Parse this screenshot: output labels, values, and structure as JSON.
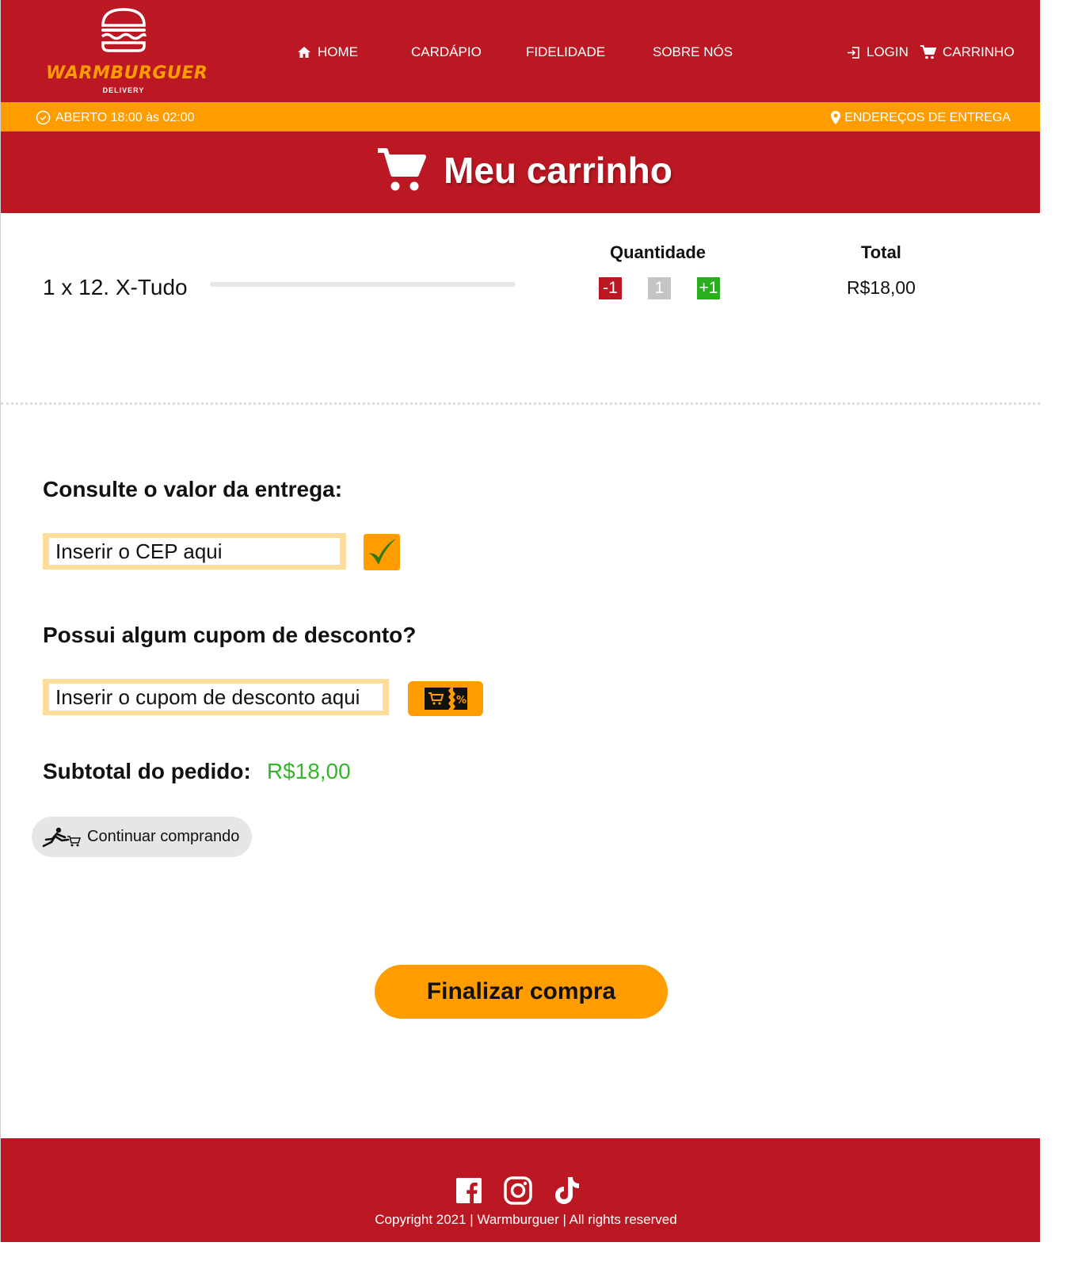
{
  "brand": {
    "name": "WARMBURGUER",
    "tagline": "DELIVERY"
  },
  "nav": {
    "home": "HOME",
    "menu": "CARDÁPIO",
    "loyalty": "FIDELIDADE",
    "about": "SOBRE NÓS",
    "login": "LOGIN",
    "cart": "CARRINHO"
  },
  "status": {
    "hours": "ABERTO 18:00 às 02:00",
    "addresses": "ENDEREÇOS DE ENTREGA"
  },
  "page": {
    "title": "Meu carrinho",
    "icon": "shopping-cart-icon"
  },
  "cart": {
    "headers": {
      "quantity": "Quantidade",
      "total": "Total"
    },
    "items": [
      {
        "name": "1 x 12. X-Tudo",
        "decrease": "-1",
        "quantity": "1",
        "increase": "+1",
        "total": "R$18,00"
      }
    ]
  },
  "delivery": {
    "title": "Consulte o valor da entrega:",
    "cep_placeholder": "Inserir o CEP aqui",
    "cep_value": "",
    "submit_icon": "checkmark-icon"
  },
  "coupon": {
    "title": "Possui algum cupom de desconto?",
    "placeholder": "Inserir o cupom de desconto aqui",
    "value": "",
    "apply_icon": "discount-coupon-icon"
  },
  "summary": {
    "subtotal_label": "Subtotal do pedido:",
    "subtotal_value": "R$18,00"
  },
  "actions": {
    "continue_label": "Continuar comprando",
    "finish_label": "Finalizar compra"
  },
  "footer": {
    "social": [
      "facebook-icon",
      "instagram-icon",
      "tiktok-icon"
    ],
    "copyright": "Copyright 2021 | Warmburguer | All rights reserved"
  },
  "colors": {
    "primary_red": "#bc1823",
    "accent_orange": "#ff9d00",
    "input_border": "#ffdc9c",
    "success_green": "#36b52a",
    "plus_green": "#2aae1e",
    "neutral_gray": "#c4c4c4"
  }
}
